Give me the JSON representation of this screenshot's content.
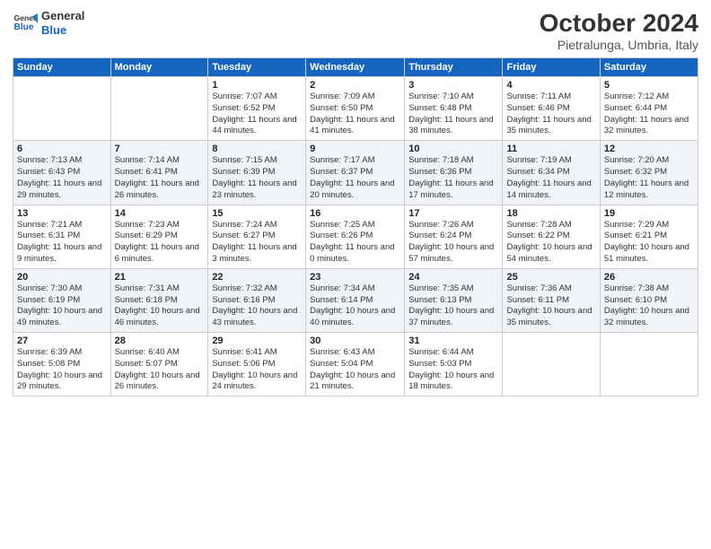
{
  "header": {
    "logo_line1": "General",
    "logo_line2": "Blue",
    "title": "October 2024",
    "subtitle": "Pietralunga, Umbria, Italy"
  },
  "weekdays": [
    "Sunday",
    "Monday",
    "Tuesday",
    "Wednesday",
    "Thursday",
    "Friday",
    "Saturday"
  ],
  "rows": [
    [
      {
        "day": "",
        "info": ""
      },
      {
        "day": "",
        "info": ""
      },
      {
        "day": "1",
        "info": "Sunrise: 7:07 AM\nSunset: 6:52 PM\nDaylight: 11 hours and 44 minutes."
      },
      {
        "day": "2",
        "info": "Sunrise: 7:09 AM\nSunset: 6:50 PM\nDaylight: 11 hours and 41 minutes."
      },
      {
        "day": "3",
        "info": "Sunrise: 7:10 AM\nSunset: 6:48 PM\nDaylight: 11 hours and 38 minutes."
      },
      {
        "day": "4",
        "info": "Sunrise: 7:11 AM\nSunset: 6:46 PM\nDaylight: 11 hours and 35 minutes."
      },
      {
        "day": "5",
        "info": "Sunrise: 7:12 AM\nSunset: 6:44 PM\nDaylight: 11 hours and 32 minutes."
      }
    ],
    [
      {
        "day": "6",
        "info": "Sunrise: 7:13 AM\nSunset: 6:43 PM\nDaylight: 11 hours and 29 minutes."
      },
      {
        "day": "7",
        "info": "Sunrise: 7:14 AM\nSunset: 6:41 PM\nDaylight: 11 hours and 26 minutes."
      },
      {
        "day": "8",
        "info": "Sunrise: 7:15 AM\nSunset: 6:39 PM\nDaylight: 11 hours and 23 minutes."
      },
      {
        "day": "9",
        "info": "Sunrise: 7:17 AM\nSunset: 6:37 PM\nDaylight: 11 hours and 20 minutes."
      },
      {
        "day": "10",
        "info": "Sunrise: 7:18 AM\nSunset: 6:36 PM\nDaylight: 11 hours and 17 minutes."
      },
      {
        "day": "11",
        "info": "Sunrise: 7:19 AM\nSunset: 6:34 PM\nDaylight: 11 hours and 14 minutes."
      },
      {
        "day": "12",
        "info": "Sunrise: 7:20 AM\nSunset: 6:32 PM\nDaylight: 11 hours and 12 minutes."
      }
    ],
    [
      {
        "day": "13",
        "info": "Sunrise: 7:21 AM\nSunset: 6:31 PM\nDaylight: 11 hours and 9 minutes."
      },
      {
        "day": "14",
        "info": "Sunrise: 7:23 AM\nSunset: 6:29 PM\nDaylight: 11 hours and 6 minutes."
      },
      {
        "day": "15",
        "info": "Sunrise: 7:24 AM\nSunset: 6:27 PM\nDaylight: 11 hours and 3 minutes."
      },
      {
        "day": "16",
        "info": "Sunrise: 7:25 AM\nSunset: 6:26 PM\nDaylight: 11 hours and 0 minutes."
      },
      {
        "day": "17",
        "info": "Sunrise: 7:26 AM\nSunset: 6:24 PM\nDaylight: 10 hours and 57 minutes."
      },
      {
        "day": "18",
        "info": "Sunrise: 7:28 AM\nSunset: 6:22 PM\nDaylight: 10 hours and 54 minutes."
      },
      {
        "day": "19",
        "info": "Sunrise: 7:29 AM\nSunset: 6:21 PM\nDaylight: 10 hours and 51 minutes."
      }
    ],
    [
      {
        "day": "20",
        "info": "Sunrise: 7:30 AM\nSunset: 6:19 PM\nDaylight: 10 hours and 49 minutes."
      },
      {
        "day": "21",
        "info": "Sunrise: 7:31 AM\nSunset: 6:18 PM\nDaylight: 10 hours and 46 minutes."
      },
      {
        "day": "22",
        "info": "Sunrise: 7:32 AM\nSunset: 6:16 PM\nDaylight: 10 hours and 43 minutes."
      },
      {
        "day": "23",
        "info": "Sunrise: 7:34 AM\nSunset: 6:14 PM\nDaylight: 10 hours and 40 minutes."
      },
      {
        "day": "24",
        "info": "Sunrise: 7:35 AM\nSunset: 6:13 PM\nDaylight: 10 hours and 37 minutes."
      },
      {
        "day": "25",
        "info": "Sunrise: 7:36 AM\nSunset: 6:11 PM\nDaylight: 10 hours and 35 minutes."
      },
      {
        "day": "26",
        "info": "Sunrise: 7:38 AM\nSunset: 6:10 PM\nDaylight: 10 hours and 32 minutes."
      }
    ],
    [
      {
        "day": "27",
        "info": "Sunrise: 6:39 AM\nSunset: 5:08 PM\nDaylight: 10 hours and 29 minutes."
      },
      {
        "day": "28",
        "info": "Sunrise: 6:40 AM\nSunset: 5:07 PM\nDaylight: 10 hours and 26 minutes."
      },
      {
        "day": "29",
        "info": "Sunrise: 6:41 AM\nSunset: 5:06 PM\nDaylight: 10 hours and 24 minutes."
      },
      {
        "day": "30",
        "info": "Sunrise: 6:43 AM\nSunset: 5:04 PM\nDaylight: 10 hours and 21 minutes."
      },
      {
        "day": "31",
        "info": "Sunrise: 6:44 AM\nSunset: 5:03 PM\nDaylight: 10 hours and 18 minutes."
      },
      {
        "day": "",
        "info": ""
      },
      {
        "day": "",
        "info": ""
      }
    ]
  ]
}
